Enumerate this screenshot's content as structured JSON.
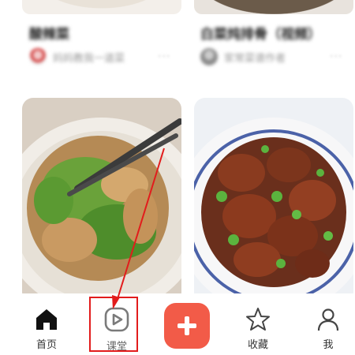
{
  "feed": {
    "cards_top": [
      {
        "title": "酸辣菜",
        "author": "妈妈教我一道菜",
        "more": "···"
      },
      {
        "title": "白菜炖排骨（视频）",
        "author": "家常菜谱作者",
        "more": "···"
      }
    ],
    "cards_main": [
      {
        "image": "stir-fried-pork-with-green-pepper"
      },
      {
        "image": "braised-pork-ribs-with-peas"
      }
    ]
  },
  "tabbar": {
    "items": [
      {
        "label": "首页",
        "icon": "home-icon",
        "active": true
      },
      {
        "label": "课堂",
        "icon": "play-icon"
      },
      {
        "label": "收藏",
        "icon": "star-icon"
      },
      {
        "label": "我",
        "icon": "user-icon"
      }
    ],
    "add_button": {
      "icon": "plus-icon",
      "color": "#f25b48"
    }
  },
  "annotation": {
    "highlight_color": "#e21c1c"
  }
}
